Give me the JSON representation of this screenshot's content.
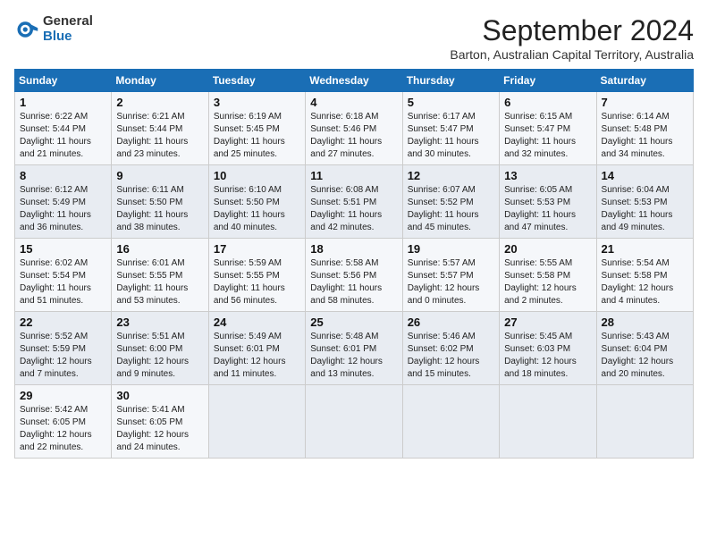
{
  "logo": {
    "general": "General",
    "blue": "Blue"
  },
  "header": {
    "month": "September 2024",
    "location": "Barton, Australian Capital Territory, Australia"
  },
  "weekdays": [
    "Sunday",
    "Monday",
    "Tuesday",
    "Wednesday",
    "Thursday",
    "Friday",
    "Saturday"
  ],
  "weeks": [
    [
      {
        "day": "1",
        "sunrise": "6:22 AM",
        "sunset": "5:44 PM",
        "daylight": "11 hours and 21 minutes."
      },
      {
        "day": "2",
        "sunrise": "6:21 AM",
        "sunset": "5:44 PM",
        "daylight": "11 hours and 23 minutes."
      },
      {
        "day": "3",
        "sunrise": "6:19 AM",
        "sunset": "5:45 PM",
        "daylight": "11 hours and 25 minutes."
      },
      {
        "day": "4",
        "sunrise": "6:18 AM",
        "sunset": "5:46 PM",
        "daylight": "11 hours and 27 minutes."
      },
      {
        "day": "5",
        "sunrise": "6:17 AM",
        "sunset": "5:47 PM",
        "daylight": "11 hours and 30 minutes."
      },
      {
        "day": "6",
        "sunrise": "6:15 AM",
        "sunset": "5:47 PM",
        "daylight": "11 hours and 32 minutes."
      },
      {
        "day": "7",
        "sunrise": "6:14 AM",
        "sunset": "5:48 PM",
        "daylight": "11 hours and 34 minutes."
      }
    ],
    [
      {
        "day": "8",
        "sunrise": "6:12 AM",
        "sunset": "5:49 PM",
        "daylight": "11 hours and 36 minutes."
      },
      {
        "day": "9",
        "sunrise": "6:11 AM",
        "sunset": "5:50 PM",
        "daylight": "11 hours and 38 minutes."
      },
      {
        "day": "10",
        "sunrise": "6:10 AM",
        "sunset": "5:50 PM",
        "daylight": "11 hours and 40 minutes."
      },
      {
        "day": "11",
        "sunrise": "6:08 AM",
        "sunset": "5:51 PM",
        "daylight": "11 hours and 42 minutes."
      },
      {
        "day": "12",
        "sunrise": "6:07 AM",
        "sunset": "5:52 PM",
        "daylight": "11 hours and 45 minutes."
      },
      {
        "day": "13",
        "sunrise": "6:05 AM",
        "sunset": "5:53 PM",
        "daylight": "11 hours and 47 minutes."
      },
      {
        "day": "14",
        "sunrise": "6:04 AM",
        "sunset": "5:53 PM",
        "daylight": "11 hours and 49 minutes."
      }
    ],
    [
      {
        "day": "15",
        "sunrise": "6:02 AM",
        "sunset": "5:54 PM",
        "daylight": "11 hours and 51 minutes."
      },
      {
        "day": "16",
        "sunrise": "6:01 AM",
        "sunset": "5:55 PM",
        "daylight": "11 hours and 53 minutes."
      },
      {
        "day": "17",
        "sunrise": "5:59 AM",
        "sunset": "5:55 PM",
        "daylight": "11 hours and 56 minutes."
      },
      {
        "day": "18",
        "sunrise": "5:58 AM",
        "sunset": "5:56 PM",
        "daylight": "11 hours and 58 minutes."
      },
      {
        "day": "19",
        "sunrise": "5:57 AM",
        "sunset": "5:57 PM",
        "daylight": "12 hours and 0 minutes."
      },
      {
        "day": "20",
        "sunrise": "5:55 AM",
        "sunset": "5:58 PM",
        "daylight": "12 hours and 2 minutes."
      },
      {
        "day": "21",
        "sunrise": "5:54 AM",
        "sunset": "5:58 PM",
        "daylight": "12 hours and 4 minutes."
      }
    ],
    [
      {
        "day": "22",
        "sunrise": "5:52 AM",
        "sunset": "5:59 PM",
        "daylight": "12 hours and 7 minutes."
      },
      {
        "day": "23",
        "sunrise": "5:51 AM",
        "sunset": "6:00 PM",
        "daylight": "12 hours and 9 minutes."
      },
      {
        "day": "24",
        "sunrise": "5:49 AM",
        "sunset": "6:01 PM",
        "daylight": "12 hours and 11 minutes."
      },
      {
        "day": "25",
        "sunrise": "5:48 AM",
        "sunset": "6:01 PM",
        "daylight": "12 hours and 13 minutes."
      },
      {
        "day": "26",
        "sunrise": "5:46 AM",
        "sunset": "6:02 PM",
        "daylight": "12 hours and 15 minutes."
      },
      {
        "day": "27",
        "sunrise": "5:45 AM",
        "sunset": "6:03 PM",
        "daylight": "12 hours and 18 minutes."
      },
      {
        "day": "28",
        "sunrise": "5:43 AM",
        "sunset": "6:04 PM",
        "daylight": "12 hours and 20 minutes."
      }
    ],
    [
      {
        "day": "29",
        "sunrise": "5:42 AM",
        "sunset": "6:05 PM",
        "daylight": "12 hours and 22 minutes."
      },
      {
        "day": "30",
        "sunrise": "5:41 AM",
        "sunset": "6:05 PM",
        "daylight": "12 hours and 24 minutes."
      },
      null,
      null,
      null,
      null,
      null
    ]
  ]
}
